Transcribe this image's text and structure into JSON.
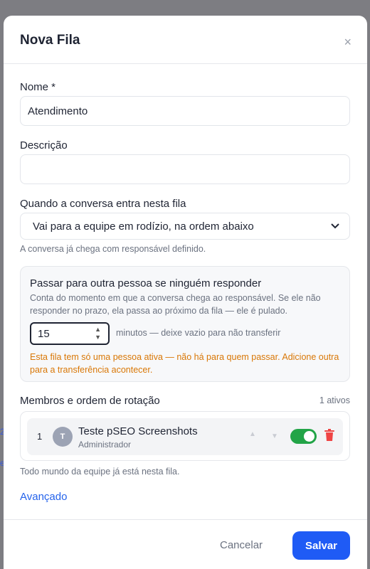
{
  "modal": {
    "title": "Nova Fila",
    "close_label": "×"
  },
  "form": {
    "name_label": "Nome *",
    "name_value": "Atendimento",
    "description_label": "Descrição",
    "description_value": "",
    "routing_label": "Quando a conversa entra nesta fila",
    "routing_selected": "Vai para a equipe em rodízio, na ordem abaixo",
    "routing_hint": "A conversa já chega com responsável definido."
  },
  "transfer": {
    "title": "Passar para outra pessoa se ninguém responder",
    "description": "Conta do momento em que a conversa chega ao responsável. Se ele não responder no prazo, ela passa ao próximo da fila — ele é pulado.",
    "minutes_value": "15",
    "minutes_suffix": "minutos — deixe vazio para não transferir",
    "warning": "Esta fila tem só uma pessoa ativa — não há para quem passar. Adicione outra para a transferência acontecer.",
    "warning_color": "#d97706"
  },
  "members": {
    "label": "Membros e ordem de rotação",
    "count": "1 ativos",
    "items": [
      {
        "position": "1",
        "initial": "T",
        "name": "Teste pSEO Screenshots",
        "role": "Administrador",
        "active": true
      }
    ],
    "hint": "Todo mundo da equipe já está nesta fila."
  },
  "advanced_label": "Avançado",
  "footer": {
    "cancel_label": "Cancelar",
    "save_label": "Salvar"
  },
  "colors": {
    "accent": "#1f5bf5",
    "toggle_on": "#22a447",
    "delete": "#ef4444"
  }
}
